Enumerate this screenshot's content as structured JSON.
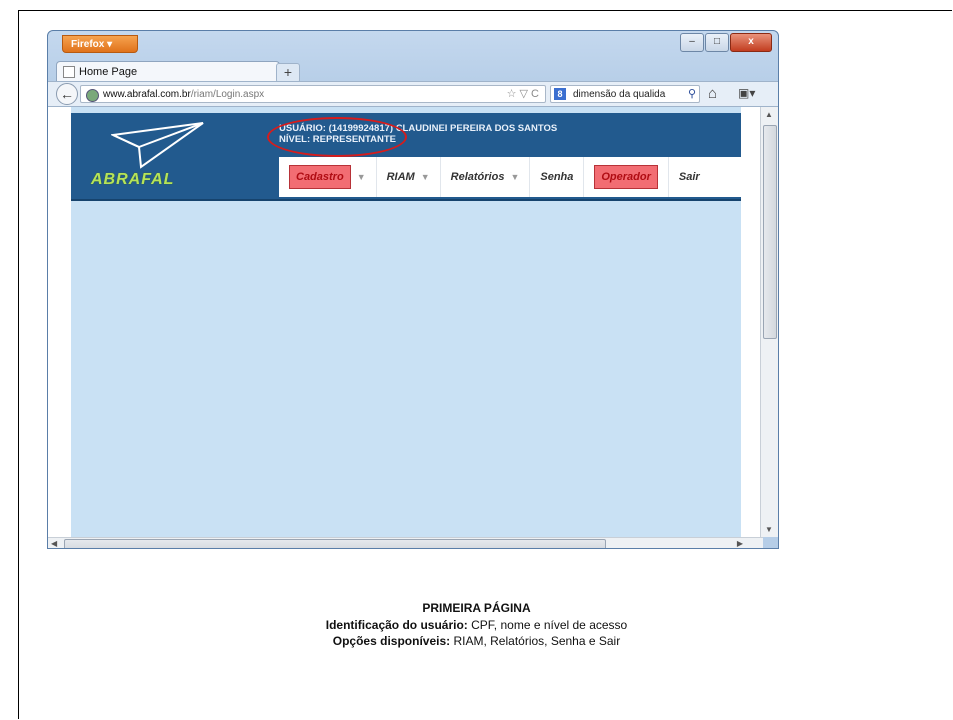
{
  "browser": {
    "app_button": "Firefox",
    "tab_title": "Home Page",
    "new_tab": "+",
    "url_host": "www.abrafal.com.br",
    "url_path": "/riam/Login.aspx",
    "url_tools": "☆ ▽ C",
    "search_engine": "8",
    "search_text": "dimensão da qualida",
    "window_controls": {
      "minimize": "–",
      "maximize": "□",
      "close": "x"
    }
  },
  "site": {
    "logo_text": "ABRAFAL",
    "user_line": "USUÁRIO: (14199924817) CLAUDINEI PEREIRA DOS SANTOS",
    "level_line": "NÍVEL: REPRESENTANTE",
    "menu": [
      {
        "label": "Cadastro",
        "has_dropdown": true,
        "highlighted": true
      },
      {
        "label": "RIAM",
        "has_dropdown": true,
        "highlighted": false
      },
      {
        "label": "Relatórios",
        "has_dropdown": true,
        "highlighted": false
      },
      {
        "label": "Senha",
        "has_dropdown": false,
        "highlighted": false
      },
      {
        "label": "Operador",
        "has_dropdown": false,
        "highlighted": true
      },
      {
        "label": "Sair",
        "has_dropdown": false,
        "highlighted": false
      }
    ]
  },
  "caption": {
    "title": "PRIMEIRA PÁGINA",
    "line1_bold": "Identificação do usuário:",
    "line1_rest": " CPF, nome e nível de acesso",
    "line2_bold": "Opções disponíveis:",
    "line2_rest": " RIAM, Relatórios, Senha e Sair"
  },
  "colors": {
    "header": "#225a8e",
    "page_bg": "#c9e1f4",
    "highlight": "#f26d73",
    "annotation": "#d61c1c"
  }
}
